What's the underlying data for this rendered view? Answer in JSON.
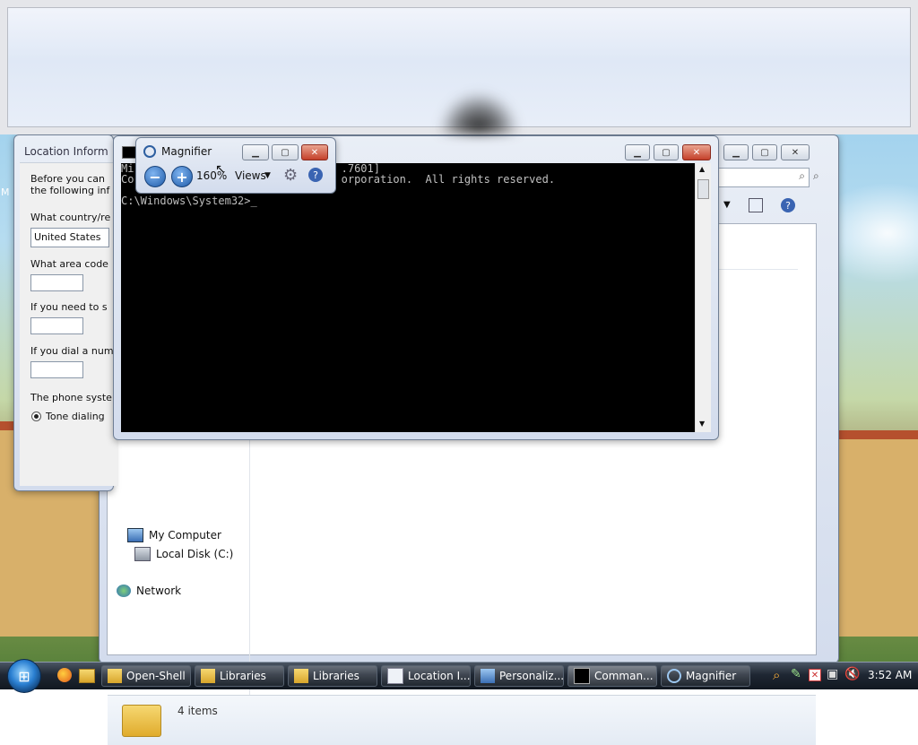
{
  "desktop": {
    "my_icon_label": "M"
  },
  "location_dialog": {
    "title": "Location Inform",
    "intro_line1": "Before you can",
    "intro_line2": "the following inf",
    "country_label": "What country/re",
    "country_value": "United States",
    "area_code_label": "What area code",
    "need_label": "If you need to s",
    "dial_label": "If you dial a num",
    "phone_system_label": "The phone syste",
    "tone_dialing_label": "Tone dialing"
  },
  "explorer": {
    "nav": {
      "my_computer": "My Computer",
      "local_disk": "Local Disk (C:)",
      "network": "Network"
    },
    "status": {
      "items": "4 items"
    }
  },
  "cmd": {
    "lines": [
      "Mi                                .7601]",
      "Co                                orporation.  All rights reserved.",
      "",
      "C:\\Windows\\System32>_"
    ]
  },
  "magnifier": {
    "title": "Magnifier",
    "zoom": "160%",
    "views": "Views"
  },
  "taskbar": {
    "buttons": [
      {
        "label": "Open-Shell"
      },
      {
        "label": "Libraries"
      },
      {
        "label": "Libraries"
      },
      {
        "label": "Location I..."
      },
      {
        "label": "Personaliz..."
      },
      {
        "label": "Comman..."
      },
      {
        "label": "Magnifier"
      }
    ],
    "clock": "3:52 AM"
  }
}
